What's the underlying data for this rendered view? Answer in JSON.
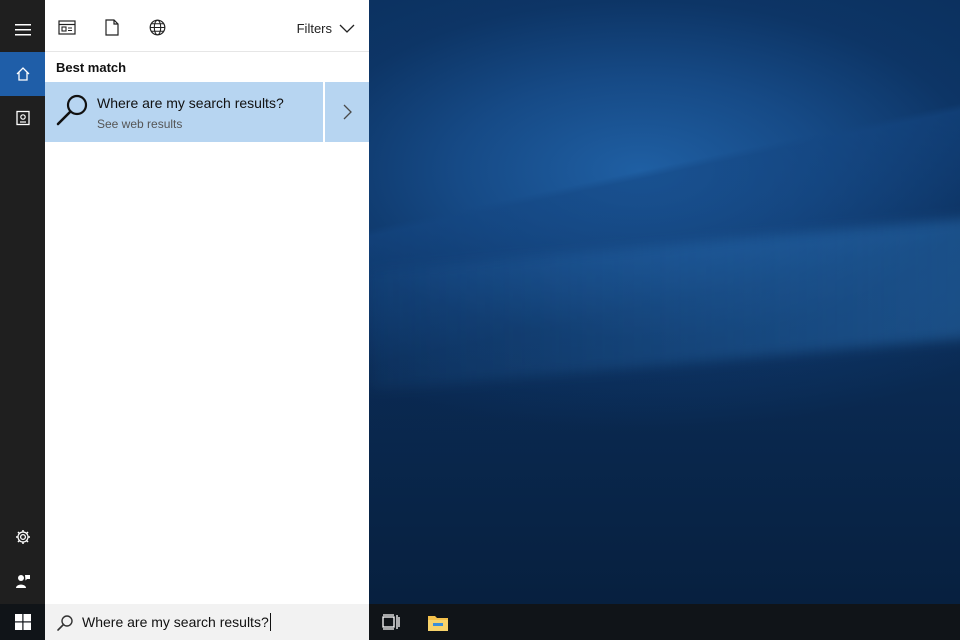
{
  "header": {
    "filters_label": "Filters"
  },
  "results": {
    "section_label": "Best match",
    "best_match": {
      "title": "Where are my search results?",
      "subtitle": "See web results"
    }
  },
  "search": {
    "query": "Where are my search results?"
  },
  "icons": {
    "rail": [
      "hamburger-menu-icon",
      "home-icon",
      "notebook-icon",
      "settings-icon",
      "feedback-icon"
    ],
    "header": [
      "apps-icon",
      "documents-icon",
      "web-icon",
      "chevron-down-icon"
    ],
    "taskbar": [
      "windows-logo-icon",
      "search-icon",
      "task-view-icon",
      "file-explorer-icon"
    ]
  },
  "colors": {
    "accent": "#1f5ea8",
    "result_highlight": "#b7d5f1",
    "rail_background": "#1f1f1f",
    "taskbar_background": "#101418"
  }
}
